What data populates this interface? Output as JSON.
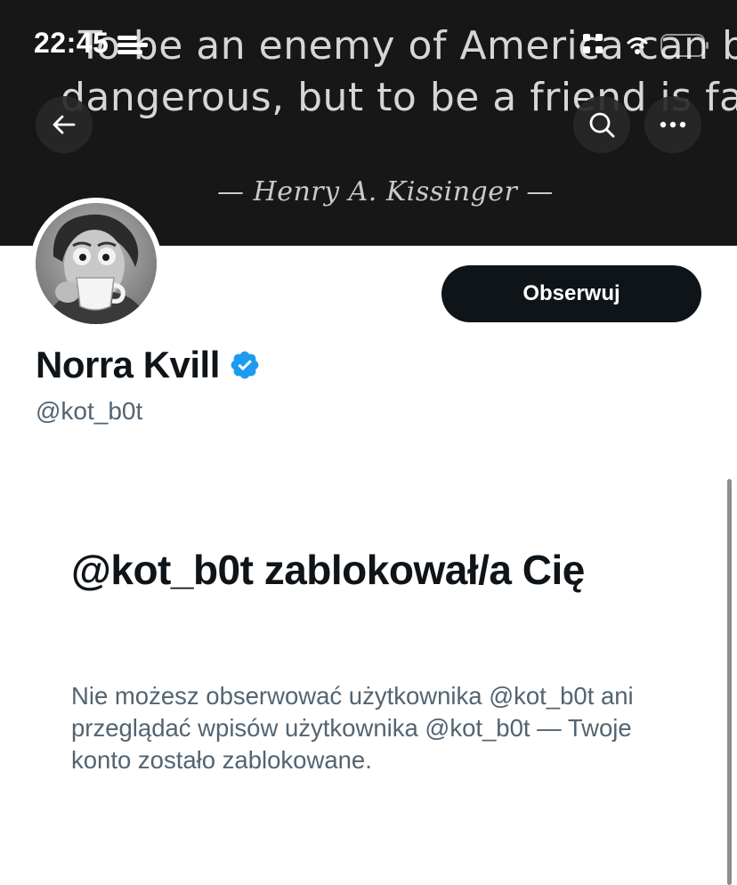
{
  "status_bar": {
    "time": "22:45",
    "icons": [
      "screen-recording-icon",
      "cellular-signal-icon",
      "wifi-icon",
      "battery-icon"
    ]
  },
  "banner": {
    "quote_line_1": "To be an enemy of America can be",
    "quote_line_2": "dangerous, but to be a friend is fatal",
    "author": "— Henry A. Kissinger —"
  },
  "nav": {
    "back_icon": "arrow-left-icon",
    "search_icon": "search-icon",
    "more_icon": "more-horizontal-icon"
  },
  "profile": {
    "display_name": "Norra Kvill",
    "handle": "@kot_b0t",
    "verified_icon": "verified-badge-icon",
    "verified_color": "#1d9bf0",
    "follow_label": "Obserwuj"
  },
  "blocked": {
    "title": "@kot_b0t zablokował/a Cię",
    "description": "Nie możesz obserwować użytkownika @kot_b0t ani przeglądać wpisów użytkownika @kot_b0t — Twoje konto zostało zablokowane."
  },
  "colors": {
    "primary_text": "#0f1419",
    "secondary_text": "#536471",
    "banner_bg": "#171717",
    "accent": "#1d9bf0"
  }
}
